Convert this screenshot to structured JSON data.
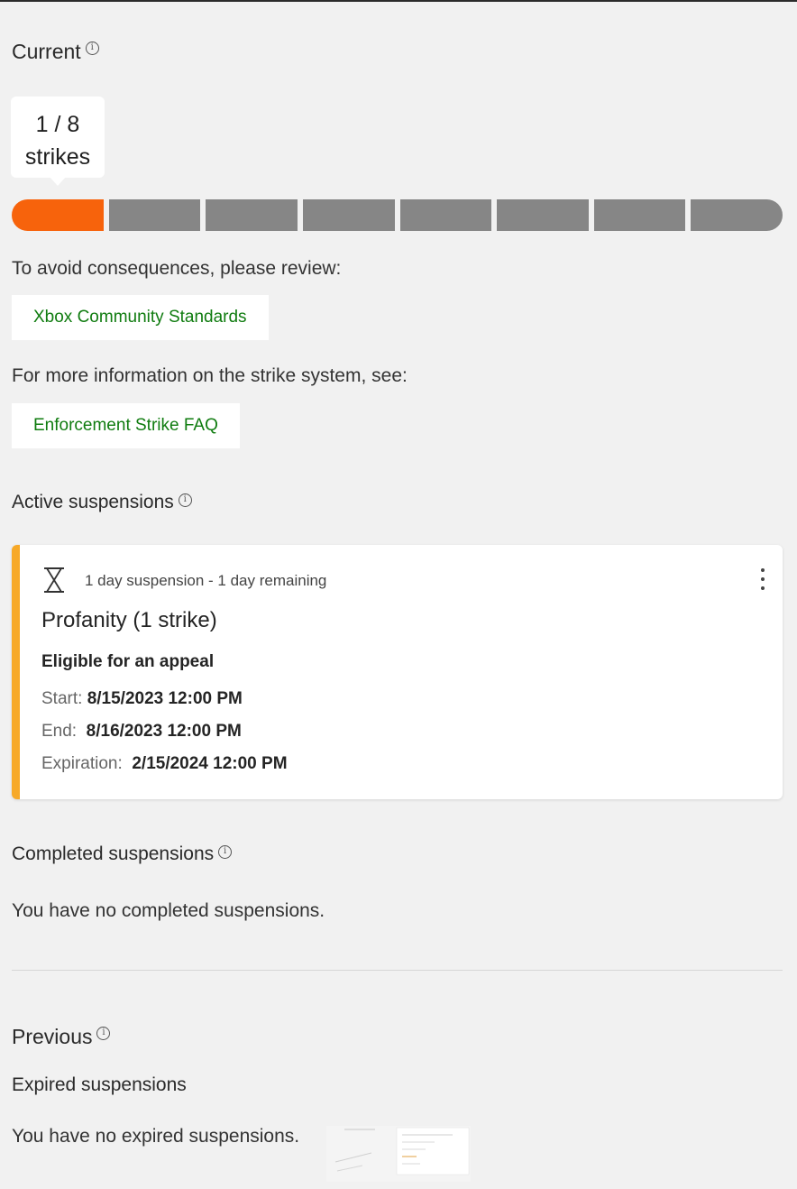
{
  "current": {
    "heading": "Current",
    "strikes_count_line": "1 / 8",
    "strikes_word": "strikes",
    "strikes_current": 1,
    "strikes_total": 8,
    "bar_color_filled": "#f7630c",
    "bar_color_empty": "#868686"
  },
  "review": {
    "text": "To avoid consequences, please review:",
    "link_label": "Xbox Community Standards"
  },
  "faq": {
    "text": "For more information on the strike system, see:",
    "link_label": "Enforcement Strike FAQ"
  },
  "active": {
    "heading": "Active suspensions",
    "card": {
      "accent_color": "#f7a928",
      "icon": "hourglass-icon",
      "duration": "1 day suspension - 1 day remaining",
      "title": "Profanity (1 strike)",
      "appeal": "Eligible for an appeal",
      "start_label": "Start:",
      "start_value": "8/15/2023 12:00 PM",
      "end_label": "End:",
      "end_value": "8/16/2023 12:00 PM",
      "expiration_label": "Expiration:",
      "expiration_value": "2/15/2024 12:00 PM"
    }
  },
  "completed": {
    "heading": "Completed suspensions",
    "empty_text": "You have no completed suspensions."
  },
  "previous": {
    "heading": "Previous",
    "expired_heading": "Expired suspensions",
    "empty_text": "You have no expired suspensions."
  }
}
